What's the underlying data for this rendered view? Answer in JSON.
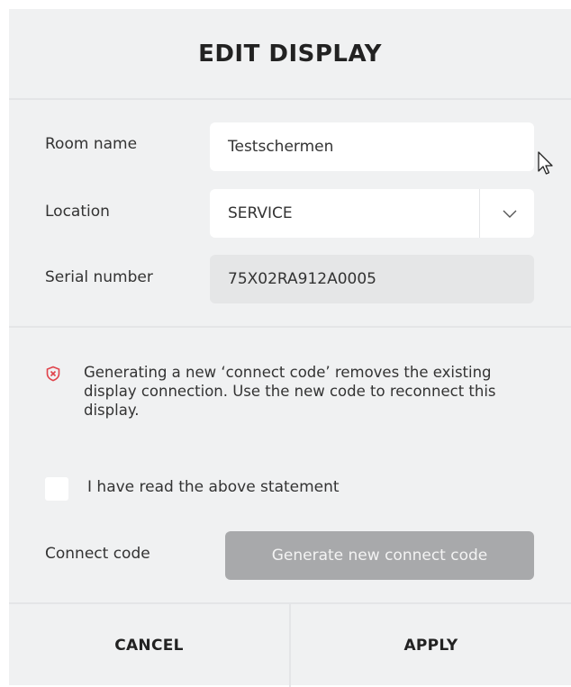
{
  "dialog": {
    "title": "EDIT DISPLAY",
    "room_name": {
      "label": "Room name",
      "value": "Testschermen"
    },
    "location": {
      "label": "Location",
      "value": "SERVICE"
    },
    "serial_number": {
      "label": "Serial number",
      "value": "75X02RA912A0005"
    },
    "warning": {
      "icon": "shield-alert-icon",
      "text": "Generating a new ‘connect code’ removes the existing display connection. Use the new code to reconnect this display."
    },
    "acknowledge": {
      "label": "I have read the above statement",
      "checked": false
    },
    "connect_code": {
      "label": "Connect code",
      "button_label": "Generate new connect code"
    },
    "footer": {
      "cancel_label": "CANCEL",
      "apply_label": "APPLY"
    }
  },
  "colors": {
    "panel": "#f0f1f2",
    "warning_icon": "#e0424a",
    "disabled_button": "#a8a9ab"
  }
}
